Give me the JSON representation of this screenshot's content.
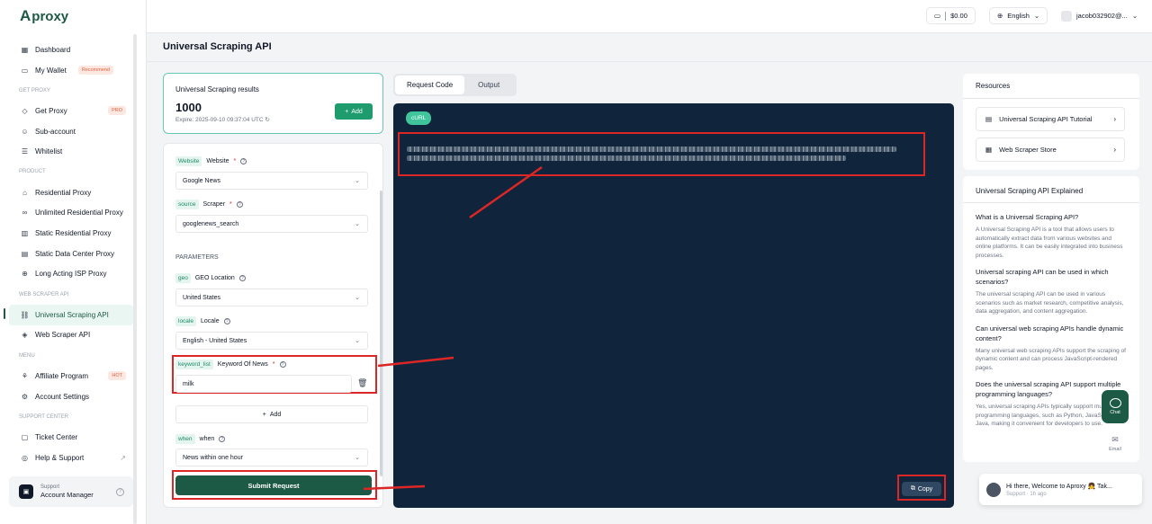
{
  "brand": {
    "name": "proxy",
    "mark": "A"
  },
  "sidebar": {
    "items": [
      {
        "type": "item",
        "label": "Dashboard",
        "icon": "grid-icon"
      },
      {
        "type": "item",
        "label": "My Wallet",
        "icon": "wallet-icon",
        "badge": "Recommend"
      },
      {
        "type": "section",
        "label": "GET PROXY"
      },
      {
        "type": "item",
        "label": "Get Proxy",
        "icon": "proxy-icon",
        "badge": "PRO"
      },
      {
        "type": "item",
        "label": "Sub-account",
        "icon": "users-icon"
      },
      {
        "type": "item",
        "label": "Whitelist",
        "icon": "list-icon"
      },
      {
        "type": "section",
        "label": "PRODUCT"
      },
      {
        "type": "item",
        "label": "Residential Proxy",
        "icon": "home-icon"
      },
      {
        "type": "item",
        "label": "Unlimited Residential Proxy",
        "icon": "infinity-icon"
      },
      {
        "type": "item",
        "label": "Static Residential Proxy",
        "icon": "building-icon"
      },
      {
        "type": "item",
        "label": "Static Data Center Proxy",
        "icon": "server-icon"
      },
      {
        "type": "item",
        "label": "Long Acting ISP Proxy",
        "icon": "globe-icon"
      },
      {
        "type": "section",
        "label": "WEB SCRAPER API"
      },
      {
        "type": "item",
        "label": "Universal Scraping API",
        "icon": "link-icon",
        "active": true
      },
      {
        "type": "item",
        "label": "Web Scraper API",
        "icon": "code-icon"
      },
      {
        "type": "section",
        "label": "MENU"
      },
      {
        "type": "item",
        "label": "Affiliate Program",
        "icon": "gift-icon",
        "badge": "HOT"
      },
      {
        "type": "item",
        "label": "Account Settings",
        "icon": "gear-icon"
      },
      {
        "type": "section",
        "label": "SUPPORT CENTER"
      },
      {
        "type": "item",
        "label": "Ticket Center",
        "icon": "ticket-icon"
      },
      {
        "type": "item",
        "label": "Help & Support",
        "icon": "help-icon",
        "external": true
      }
    ],
    "support": {
      "line1": "Support",
      "line2": "Account Manager"
    }
  },
  "topbar": {
    "balance": "$0.00",
    "language": "English",
    "user": "jacob032902@..."
  },
  "page": {
    "title": "Universal Scraping API"
  },
  "results": {
    "title": "Universal Scraping results",
    "value": "1000",
    "expire": "Expire: 2025-09-10 09:37:04 UTC",
    "add_label": "Add"
  },
  "form": {
    "website": {
      "key": "Website",
      "label": "Website",
      "value": "Google News"
    },
    "source": {
      "key": "source",
      "label": "Scraper",
      "value": "googlenews_search"
    },
    "parameters_title": "PARAMETERS",
    "geo": {
      "key": "geo",
      "label": "GEO Location",
      "value": "United States"
    },
    "locale": {
      "key": "locale",
      "label": "Locale",
      "value": "English - United States"
    },
    "keyword": {
      "key": "keyword_list",
      "label": "Keyword Of News",
      "value": "milk"
    },
    "add_row_label": "Add",
    "when": {
      "key": "when",
      "label": "when",
      "value": "News within one hour"
    },
    "submit_label": "Submit Request"
  },
  "tabs": [
    {
      "label": "Request Code",
      "active": true
    },
    {
      "label": "Output",
      "active": false
    }
  ],
  "code": {
    "language_tag": "cURL",
    "copy_label": "Copy"
  },
  "resources": {
    "title": "Resources",
    "links": [
      {
        "label": "Universal Scraping API Tutorial",
        "icon": "doc-icon"
      },
      {
        "label": "Web Scraper Store",
        "icon": "store-icon"
      }
    ]
  },
  "explained": {
    "title": "Universal Scraping API Explained",
    "faq": [
      {
        "q": "What is a Universal Scraping API?",
        "a": "A Universal Scraping API is a tool that allows users to automatically extract data from various websites and online platforms. It can be easily integrated into business processes."
      },
      {
        "q": "Universal scraping API can be used in which scenarios?",
        "a": "The universal scraping API can be used in various scenarios such as market research, competitive analysis, data aggregation, and content aggregation."
      },
      {
        "q": "Can universal web scraping APIs handle dynamic content?",
        "a": "Many universal web scraping APIs support the scraping of dynamic content and can process JavaScript-rendered pages."
      },
      {
        "q": "Does the universal scraping API support multiple programming languages?",
        "a": "Yes, universal scraping APIs typically support multiple programming languages, such as Python, JavaScript, and Java, making it convenient for developers to use."
      }
    ]
  },
  "widgets": {
    "chat_label": "Chat",
    "email_label": "Email",
    "toast_message": "Hi there, Welcome to Aproxy 👧 Tak...",
    "toast_meta": "Support · 1h ago"
  },
  "colors": {
    "brand": "#1d5a45",
    "accent": "#1f9c6e",
    "annotation": "#dc2626",
    "code_bg": "#10253b"
  }
}
